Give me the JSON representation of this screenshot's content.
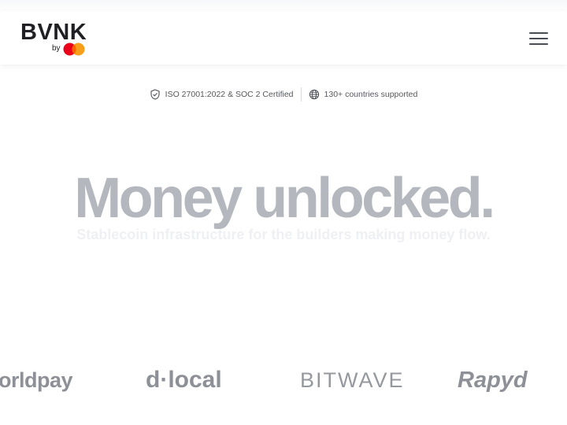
{
  "header": {
    "logo_text": "BVNK",
    "logo_by": "by",
    "brand_mark_colors": [
      "#eb001b",
      "#f79e1b",
      "#ff5f00"
    ],
    "menu_icon": "hamburger-menu-icon"
  },
  "badges": [
    {
      "icon": "shield-check-icon",
      "label": "ISO 27001:2022 & SOC 2 Certified"
    },
    {
      "icon": "globe-icon",
      "label": "130+ countries supported"
    }
  ],
  "hero": {
    "headline": "Money unlocked.",
    "subheadline": "Stablecoin infrastructure for the builders making money flow."
  },
  "partners": {
    "logos": [
      "orldpay",
      "d·local",
      "BITWAVE",
      "Rapyd"
    ]
  },
  "colors": {
    "headline": "#b4b8be",
    "subheadline": "#eef0f3",
    "partner_logos": "#8d9096",
    "text_dark": "#1f1f24"
  }
}
